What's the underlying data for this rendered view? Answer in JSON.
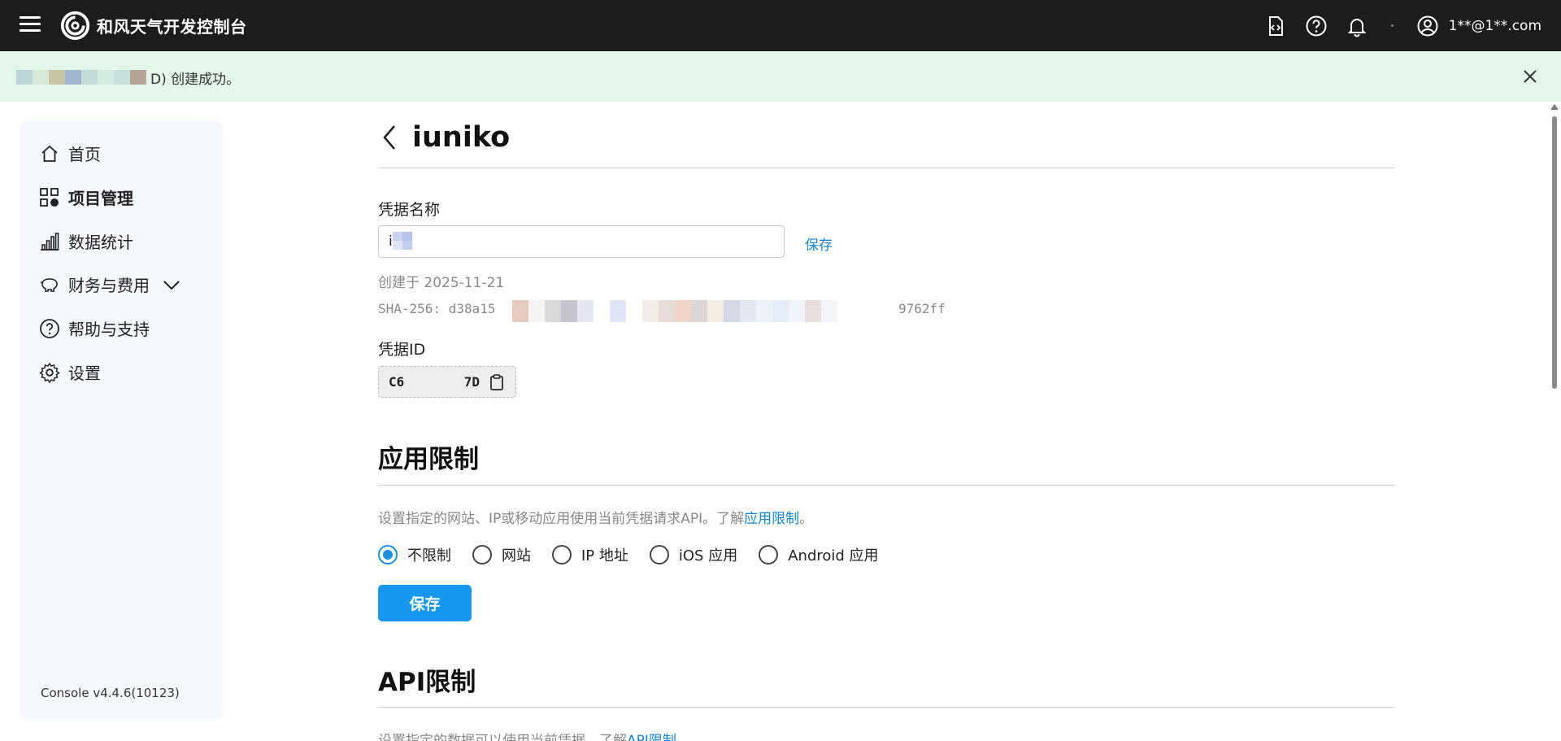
{
  "header": {
    "brand": "和风天气开发控制台",
    "user_email": "1**@1**.com",
    "icons": [
      "code-doc-icon",
      "help-icon",
      "bell-icon",
      "user-icon"
    ]
  },
  "banner": {
    "text": "D) 创建成功。"
  },
  "sidebar": {
    "items": [
      {
        "label": "首页",
        "icon": "home-icon"
      },
      {
        "label": "项目管理",
        "icon": "grid-icon"
      },
      {
        "label": "数据统计",
        "icon": "bar-chart-icon"
      },
      {
        "label": "财务与费用",
        "icon": "piggy-bank-icon"
      },
      {
        "label": "帮助与支持",
        "icon": "help-icon"
      },
      {
        "label": "设置",
        "icon": "gear-icon"
      }
    ],
    "version": "Console v4.4.6(10123)"
  },
  "main": {
    "title": "iuniko",
    "name_label": "凭据名称",
    "name_value": "i",
    "save_link": "保存",
    "created": "创建于 2025-11-21",
    "sha_prefix": "SHA-256: d38a15d",
    "sha_suffix": "9762ff",
    "cred_id_label": "凭据ID",
    "cred_id_start": "C6",
    "cred_id_end": "7D",
    "app_restriction": {
      "title": "应用限制",
      "desc_prefix": "设置指定的网站、IP或移动应用使用当前凭据请求API。了解",
      "desc_link": "应用限制",
      "desc_suffix": "。",
      "options": [
        "不限制",
        "网站",
        "IP 地址",
        "iOS 应用",
        "Android 应用"
      ],
      "selected": "不限制",
      "save_button": "保存"
    },
    "api_restriction": {
      "title": "API限制",
      "desc_prefix": "设置指定的数据可以使用当前凭据。了解",
      "desc_link": "API限制"
    }
  },
  "colors": {
    "accent": "#1698f0",
    "link": "#1286d9",
    "banner_bg": "#e3f6ea",
    "topbar_bg": "#1c1c1c"
  }
}
